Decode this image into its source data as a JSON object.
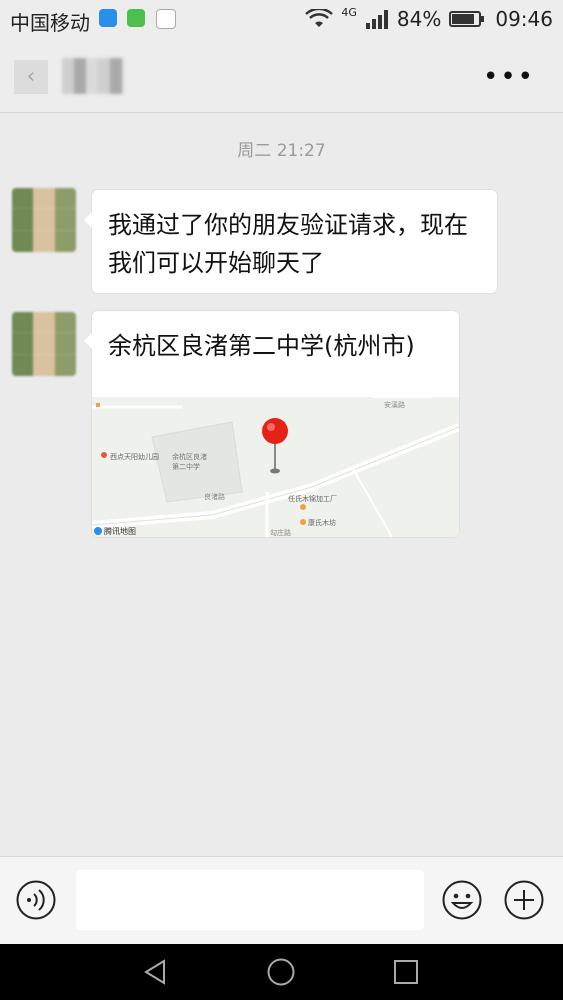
{
  "status_bar": {
    "carrier": "中国移动",
    "network": "4G",
    "battery": "84%",
    "battery_level": 0.84,
    "time": "09:46"
  },
  "nav": {
    "back_icon": "back-chevron-icon",
    "more_icon": "more-dots-icon"
  },
  "chat": {
    "timestamp": "周二 21:27",
    "messages": [
      {
        "type": "text",
        "text": "我通过了你的朋友验证请求，现在我们可以开始聊天了"
      },
      {
        "type": "location",
        "title": "余杭区良渚第二中学(杭州市)",
        "map_labels": {
          "poi1": "西点天阳幼儿园",
          "poi2": "余杭区良渚",
          "poi3": "第二中学",
          "poi4": "任氏木锦加工厂",
          "poi5": "康氏木坊",
          "road1": "安溪路",
          "road2": "良渚路",
          "road3": "勾庄路",
          "provider": "腾讯地图"
        }
      }
    ]
  },
  "input_bar": {
    "placeholder": "",
    "voice_icon": "voice-icon",
    "emoji_icon": "emoji-icon",
    "plus_icon": "plus-icon"
  },
  "colors": {
    "background": "#ebebeb",
    "bubble": "#ffffff",
    "pin": "#e52218"
  }
}
